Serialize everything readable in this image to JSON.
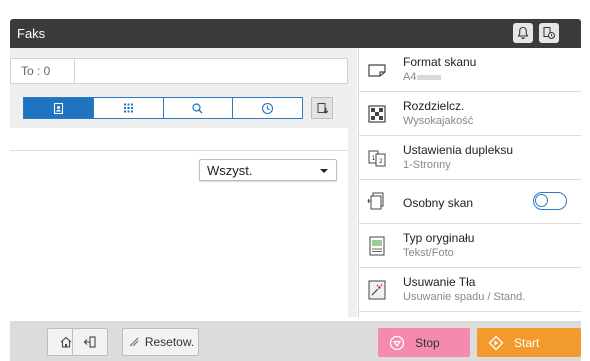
{
  "app": {
    "title": "Faks"
  },
  "header": {
    "icons": [
      "bell-icon",
      "job-history-icon"
    ]
  },
  "recipient": {
    "label": "To : 0",
    "value": ""
  },
  "tabs": [
    {
      "icon": "address-book-icon",
      "active": true
    },
    {
      "icon": "keypad-icon",
      "active": false
    },
    {
      "icon": "search-icon",
      "active": false
    },
    {
      "icon": "history-icon",
      "active": false
    }
  ],
  "list_filter": {
    "selected": "Wszyst."
  },
  "settings": [
    {
      "title": "Format skanu",
      "value": "A4"
    },
    {
      "title": "Rozdzielcz.",
      "value": "Wysokajakość"
    },
    {
      "title": "Ustawienia dupleksu",
      "value": "1-Stronny"
    },
    {
      "title": "Osobny skan",
      "toggle": false
    },
    {
      "title": "Typ oryginału",
      "value": "Tekst/Foto"
    },
    {
      "title": "Usuwanie Tła",
      "value": "Usuwanie spadu / Stand."
    }
  ],
  "footer": {
    "reset_label": "Resetow.",
    "stop_label": "Stop",
    "start_label": "Start"
  },
  "colors": {
    "accent": "#1f73c0",
    "stop": "#f58ab0",
    "start": "#f39a2e",
    "titlebar": "#3b3b3b"
  }
}
